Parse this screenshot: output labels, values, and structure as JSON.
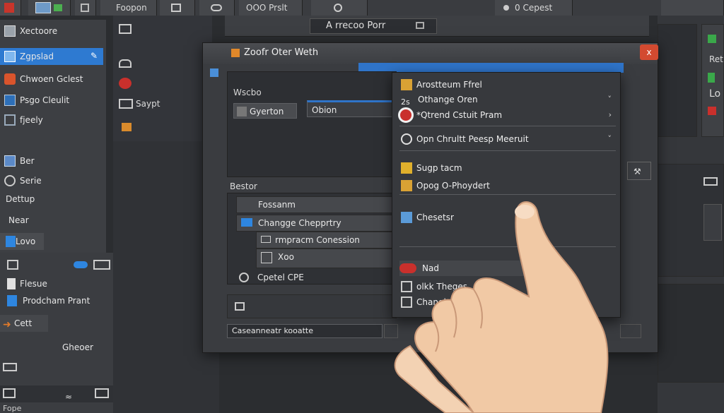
{
  "topbar": {
    "tab_a": "Foopon",
    "tab_b": "OOO Prslt",
    "tab_c": "0 Cepest",
    "center_title": "A rrecoo Porr"
  },
  "sidebar": {
    "items": [
      {
        "label": "Xectoore",
        "icon": "window-icon"
      },
      {
        "label": "Zgpslad",
        "icon": "image-icon",
        "selected": true
      },
      {
        "label": "Chwoen Gclest",
        "icon": "stop-icon"
      },
      {
        "label": "Psgo Cleulit",
        "icon": "document-icon"
      },
      {
        "label": "fjeely",
        "icon": "grid-icon"
      },
      {
        "label": "Ber",
        "icon": "monitor-icon"
      },
      {
        "label": "Serie",
        "icon": "plugin-icon"
      },
      {
        "label": "Dettup",
        "icon": ""
      },
      {
        "label": "Near",
        "icon": ""
      },
      {
        "label": "Lovo",
        "icon": "blue-square-icon"
      }
    ]
  },
  "lower_left": {
    "items": [
      {
        "label": "Flesue",
        "icon": "file-icon"
      },
      {
        "label": "Prodcham Prant",
        "icon": "doc-blue-icon"
      },
      {
        "label": "Cett",
        "icon": "arrow-icon"
      },
      {
        "label": "Gheoer",
        "icon": ""
      },
      {
        "label": "Fope",
        "icon": ""
      }
    ]
  },
  "col2": {
    "label": "Saypt"
  },
  "dialog": {
    "title": "Zoofr Oter Weth",
    "close": "x",
    "section_label": "Wscbo",
    "field1": "Gyerton",
    "field2": "Obion",
    "group_label": "Bestor",
    "list": [
      "Fossanm",
      "Changge Chepprtry",
      "rmpracm Conession",
      "Xoo",
      "Cpetel CPE"
    ],
    "footer_field": "Caseanneatr kooatte"
  },
  "menu": {
    "items": [
      {
        "label": "Arostteum Ffrel",
        "icon": "folder-icon",
        "chev": ""
      },
      {
        "label": "Othange Oren",
        "icon": "",
        "prefix": "2s",
        "chev": "˅"
      },
      {
        "label": "*Qtrend Cstuit Pram",
        "icon": "record-icon",
        "chev": "›"
      },
      {
        "label": "Opn Chrultt Peesp Meeruit",
        "icon": "clock-icon",
        "chev": "˅"
      },
      {
        "label": "Sugp tacm",
        "icon": "lock-icon",
        "chev": ""
      },
      {
        "label": "Opog O-Phoydert",
        "icon": "folder-icon",
        "chev": ""
      },
      {
        "label": "Chesetsr",
        "icon": "page-icon",
        "chev": ""
      },
      {
        "label": "Nad",
        "icon": "red-badge-icon",
        "chev": ""
      },
      {
        "label": "olkk Theges",
        "icon": "grid-icon",
        "chev": ""
      },
      {
        "label": "Changlewsle",
        "icon": "list-icon",
        "chev": ""
      }
    ]
  },
  "right_panel": {
    "label_a": "Ret",
    "label_b": "Lo"
  }
}
